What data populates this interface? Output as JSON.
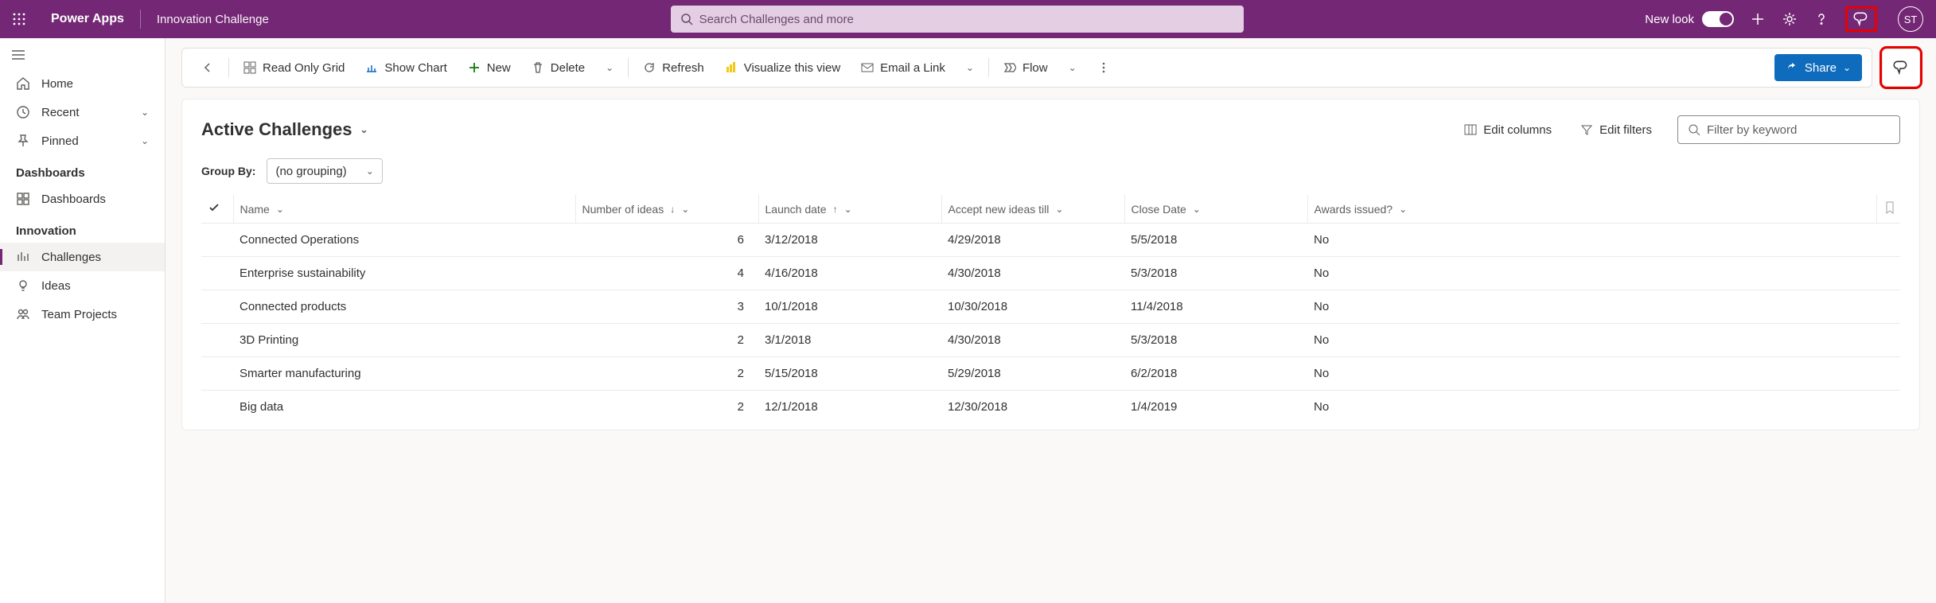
{
  "header": {
    "brand": "Power Apps",
    "app_name": "Innovation Challenge",
    "search_placeholder": "Search Challenges and more",
    "new_look_label": "New look",
    "avatar_initials": "ST"
  },
  "sidebar": {
    "home": "Home",
    "recent": "Recent",
    "pinned": "Pinned",
    "section_dashboards": "Dashboards",
    "dashboards": "Dashboards",
    "section_innovation": "Innovation",
    "challenges": "Challenges",
    "ideas": "Ideas",
    "team_projects": "Team Projects"
  },
  "commands": {
    "back": "Back",
    "read_only_grid": "Read Only Grid",
    "show_chart": "Show Chart",
    "new": "New",
    "delete": "Delete",
    "refresh": "Refresh",
    "visualize": "Visualize this view",
    "email": "Email a Link",
    "flow": "Flow",
    "share": "Share"
  },
  "view": {
    "title": "Active Challenges",
    "edit_columns": "Edit columns",
    "edit_filters": "Edit filters",
    "filter_placeholder": "Filter by keyword",
    "group_by_label": "Group By:",
    "group_by_value": "(no grouping)"
  },
  "columns": {
    "name": "Name",
    "ideas": "Number of ideas",
    "launch": "Launch date",
    "accept": "Accept new ideas till",
    "close": "Close Date",
    "awards": "Awards issued?"
  },
  "rows": [
    {
      "name": "Connected Operations",
      "ideas": "6",
      "launch": "3/12/2018",
      "accept": "4/29/2018",
      "close": "5/5/2018",
      "awards": "No"
    },
    {
      "name": "Enterprise sustainability",
      "ideas": "4",
      "launch": "4/16/2018",
      "accept": "4/30/2018",
      "close": "5/3/2018",
      "awards": "No"
    },
    {
      "name": "Connected products",
      "ideas": "3",
      "launch": "10/1/2018",
      "accept": "10/30/2018",
      "close": "11/4/2018",
      "awards": "No"
    },
    {
      "name": "3D Printing",
      "ideas": "2",
      "launch": "3/1/2018",
      "accept": "4/30/2018",
      "close": "5/3/2018",
      "awards": "No"
    },
    {
      "name": "Smarter manufacturing",
      "ideas": "2",
      "launch": "5/15/2018",
      "accept": "5/29/2018",
      "close": "6/2/2018",
      "awards": "No"
    },
    {
      "name": "Big data",
      "ideas": "2",
      "launch": "12/1/2018",
      "accept": "12/30/2018",
      "close": "1/4/2019",
      "awards": "No"
    }
  ]
}
